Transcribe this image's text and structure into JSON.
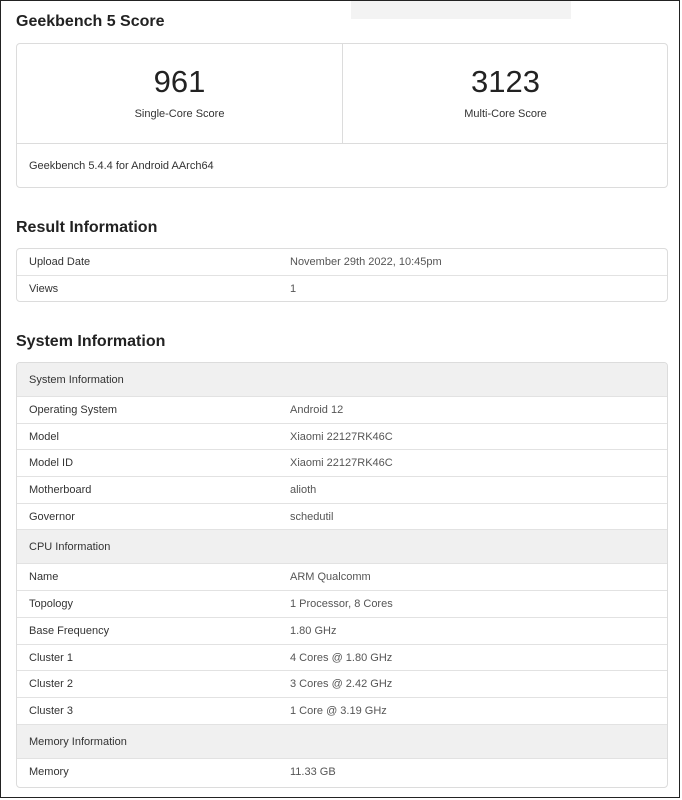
{
  "score": {
    "title": "Geekbench 5 Score",
    "single": {
      "value": "961",
      "label": "Single-Core Score"
    },
    "multi": {
      "value": "3123",
      "label": "Multi-Core Score"
    },
    "version": "Geekbench 5.4.4 for Android AArch64"
  },
  "result": {
    "title": "Result Information",
    "rows": [
      {
        "key": "Upload Date",
        "value": "November 29th 2022, 10:45pm"
      },
      {
        "key": "Views",
        "value": "1"
      }
    ]
  },
  "system": {
    "title": "System Information",
    "sections": [
      {
        "head": "System Information",
        "rows": [
          {
            "key": "Operating System",
            "value": "Android 12"
          },
          {
            "key": "Model",
            "value": "Xiaomi 22127RK46C"
          },
          {
            "key": "Model ID",
            "value": "Xiaomi 22127RK46C"
          },
          {
            "key": "Motherboard",
            "value": "alioth"
          },
          {
            "key": "Governor",
            "value": "schedutil"
          }
        ]
      },
      {
        "head": "CPU Information",
        "rows": [
          {
            "key": "Name",
            "value": "ARM Qualcomm"
          },
          {
            "key": "Topology",
            "value": "1 Processor, 8 Cores"
          },
          {
            "key": "Base Frequency",
            "value": "1.80 GHz"
          },
          {
            "key": "Cluster 1",
            "value": "4 Cores @ 1.80 GHz"
          },
          {
            "key": "Cluster 2",
            "value": "3 Cores @ 2.42 GHz"
          },
          {
            "key": "Cluster 3",
            "value": "1 Core @ 3.19 GHz"
          }
        ]
      },
      {
        "head": "Memory Information",
        "rows": [
          {
            "key": "Memory",
            "value": "11.33 GB"
          }
        ]
      }
    ]
  }
}
